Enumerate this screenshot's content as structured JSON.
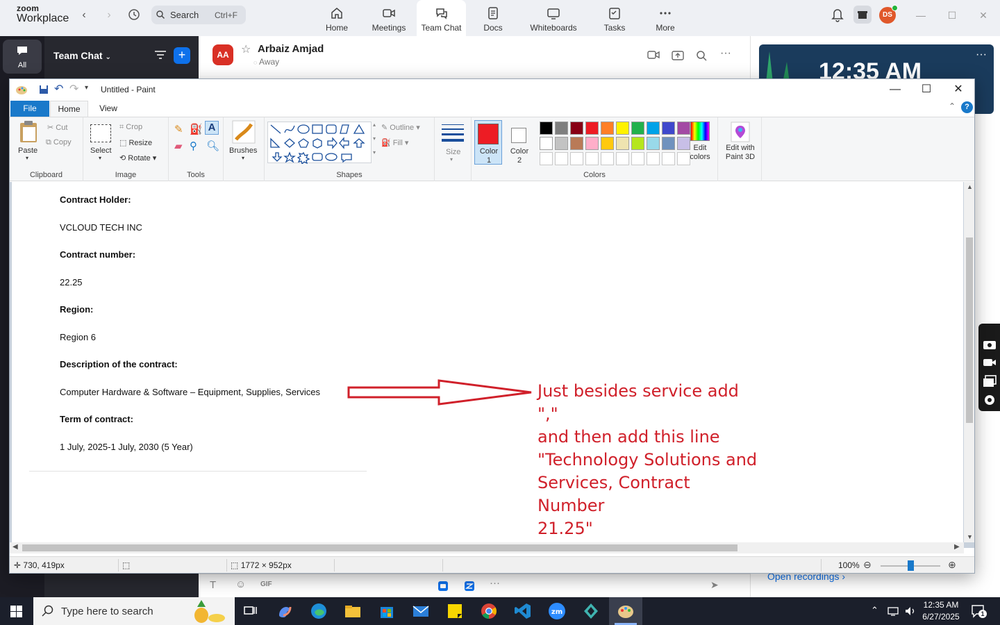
{
  "zoom": {
    "logo_line1": "zoom",
    "logo_line2": "Workplace",
    "search_label": "Search",
    "search_shortcut": "Ctrl+F",
    "tabs": [
      {
        "label": "Home"
      },
      {
        "label": "Meetings"
      },
      {
        "label": "Team Chat"
      },
      {
        "label": "Docs"
      },
      {
        "label": "Whiteboards"
      },
      {
        "label": "Tasks"
      },
      {
        "label": "More"
      }
    ],
    "avatar_initials": "DS",
    "rail_all_label": "All",
    "panel_title": "Team Chat",
    "chat_contact": {
      "initials": "AA",
      "name": "Arbaiz Amjad",
      "status": "Away"
    },
    "clock_time": "12:35 AM",
    "open_recordings": "Open recordings"
  },
  "paint": {
    "window_title": "Untitled - Paint",
    "tabs": {
      "file": "File",
      "home": "Home",
      "view": "View"
    },
    "ribbon": {
      "clipboard": {
        "group": "Clipboard",
        "paste": "Paste",
        "cut": "Cut",
        "copy": "Copy"
      },
      "image": {
        "group": "Image",
        "select": "Select",
        "crop": "Crop",
        "resize": "Resize",
        "rotate": "Rotate"
      },
      "tools": {
        "group": "Tools"
      },
      "brushes": "Brushes",
      "shapes": {
        "group": "Shapes",
        "outline": "Outline",
        "fill": "Fill"
      },
      "size": "Size",
      "colors": {
        "group": "Colors",
        "color1": "Color",
        "color1_num": "1",
        "color2": "Color",
        "color2_num": "2",
        "edit_colors_1": "Edit",
        "edit_colors_2": "colors",
        "color1_value": "#ed1c24",
        "color2_value": "#ffffff",
        "palette_row1": [
          "#000000",
          "#7f7f7f",
          "#880015",
          "#ed1c24",
          "#ff7f27",
          "#fff200",
          "#22b14c",
          "#00a2e8",
          "#3f48cc",
          "#a349a4"
        ],
        "palette_row2": [
          "#ffffff",
          "#c3c3c3",
          "#b97a57",
          "#ffaec9",
          "#ffc90e",
          "#efe4b0",
          "#b5e61d",
          "#99d9ea",
          "#7092be",
          "#c8bfe7"
        ]
      },
      "paint3d_1": "Edit with",
      "paint3d_2": "Paint 3D"
    },
    "document": {
      "lines": [
        {
          "text": "Contract Holder:",
          "bold": true
        },
        {
          "text": "VCLOUD TECH INC",
          "bold": false
        },
        {
          "text": "Contract number:",
          "bold": true
        },
        {
          "text": "22.25",
          "bold": false
        },
        {
          "text": "Region:",
          "bold": true
        },
        {
          "text": "Region 6",
          "bold": false
        },
        {
          "text": "Description of the contract:",
          "bold": true
        },
        {
          "text": "Computer Hardware & Software – Equipment, Supplies, Services",
          "bold": false
        },
        {
          "text": "Term of contract:",
          "bold": true
        },
        {
          "text": "1 July, 2025-1 July, 2030 (5 Year)",
          "bold": false
        }
      ],
      "annotation": {
        "line1": "Just besides service add \",\"",
        "line2": "and then add this line",
        "line3": "\"Technology Solutions and",
        "line4": "Services, Contract Number",
        "line5": "21.25\"",
        "color": "#d0202a"
      }
    },
    "status": {
      "cursor_pos": "730, 419px",
      "canvas_size": "1772 × 952px",
      "zoom": "100%",
      "zoom_level": 0.5
    }
  },
  "taskbar": {
    "search_placeholder": "Type here to search",
    "time": "12:35 AM",
    "date": "6/27/2025",
    "notification_count": "1"
  }
}
